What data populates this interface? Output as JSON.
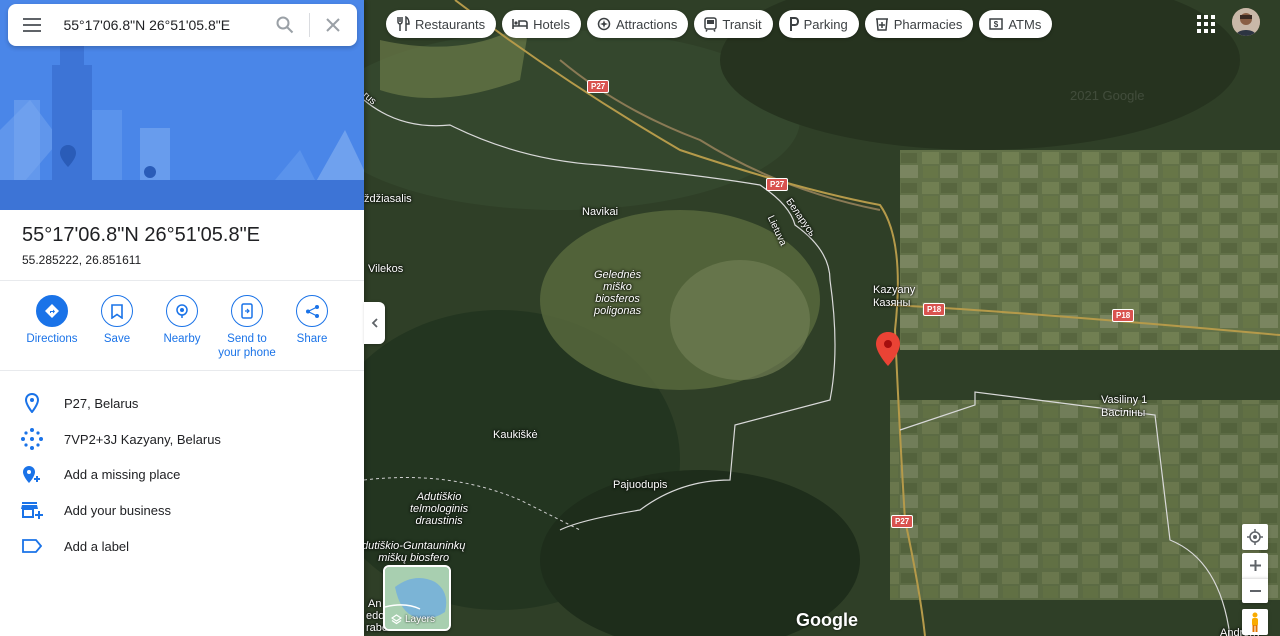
{
  "search": {
    "value": "55°17'06.8\"N 26°51'05.8\"E"
  },
  "place": {
    "title": "55°17'06.8\"N 26°51'05.8\"E",
    "coords": "55.285222, 26.851611"
  },
  "actions": [
    {
      "label": "Directions"
    },
    {
      "label": "Save"
    },
    {
      "label": "Nearby"
    },
    {
      "label": "Send to your phone"
    },
    {
      "label": "Share"
    }
  ],
  "info": [
    {
      "text": "P27, Belarus",
      "icon": "location-pin-icon"
    },
    {
      "text": "7VP2+3J Kazyany, Belarus",
      "icon": "plus-code-icon"
    },
    {
      "text": "Add a missing place",
      "icon": "add-place-icon"
    },
    {
      "text": "Add your business",
      "icon": "add-business-icon"
    },
    {
      "text": "Add a label",
      "icon": "label-icon"
    }
  ],
  "chips": [
    {
      "label": "Restaurants",
      "icon": "restaurant-icon"
    },
    {
      "label": "Hotels",
      "icon": "hotel-icon"
    },
    {
      "label": "Attractions",
      "icon": "attraction-icon"
    },
    {
      "label": "Transit",
      "icon": "transit-icon"
    },
    {
      "label": "Parking",
      "icon": "parking-icon"
    },
    {
      "label": "Pharmacies",
      "icon": "pharmacy-icon"
    },
    {
      "label": "ATMs",
      "icon": "atm-icon"
    }
  ],
  "map": {
    "labels": [
      "Navikai",
      "Kazyany",
      "Казяны",
      "Vilekos",
      "Kaukiškė",
      "Pajuodupis",
      "Vasiliny 1",
      "Васіліны",
      "ždžiasalis",
      "Androny",
      "An",
      "edo",
      "rabe"
    ],
    "italic_labels": [
      "Gelednės\nmiško\nbiosferos\npoligonas",
      "Adutiškio\ntelmologinis\ndraustinis",
      "dutiškio-Guntauninkų\nmiškų biosfero"
    ],
    "road_shields": [
      "P27",
      "P27",
      "P18",
      "P18",
      "P27"
    ],
    "road_names": [
      "Беларусь",
      "Lietuva",
      "rus"
    ],
    "layers_label": "Layers",
    "brand": "Google",
    "watermark": "2021 Google"
  },
  "colors": {
    "accent": "#1a73e8",
    "marker": "#ea4335",
    "hero": "#4a86e8"
  }
}
